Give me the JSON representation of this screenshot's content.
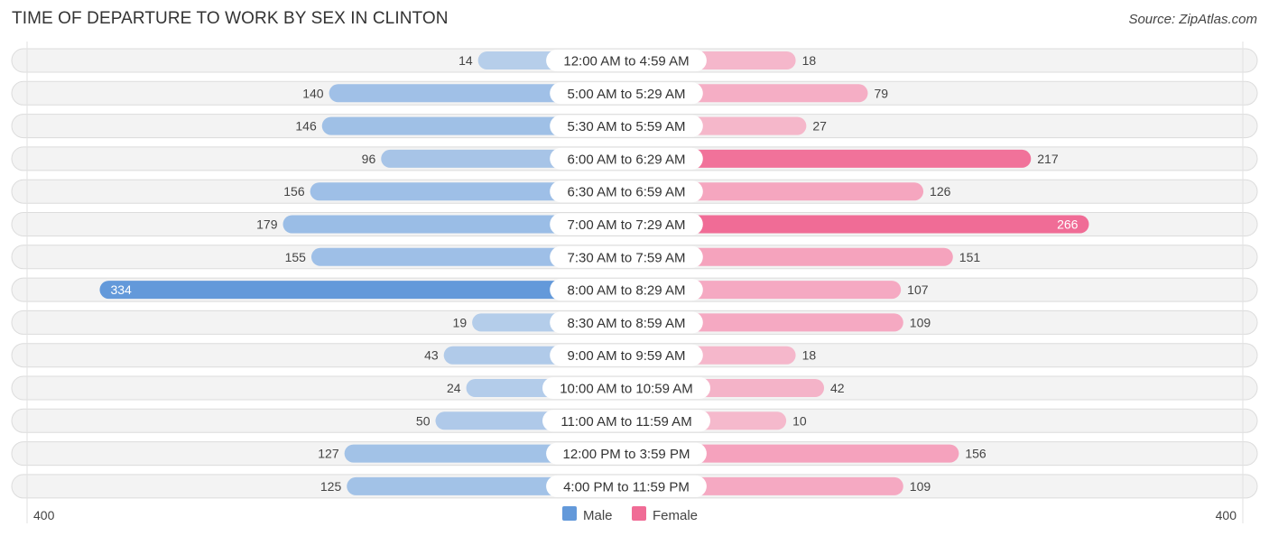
{
  "header": {
    "title": "TIME OF DEPARTURE TO WORK BY SEX IN CLINTON",
    "source": "Source: ZipAtlas.com"
  },
  "colors": {
    "male": "#8fb6e4",
    "male_strong": "#6399da",
    "female": "#f594b3",
    "female_strong": "#f06c96"
  },
  "chart_data": {
    "type": "bar",
    "orientation": "horizontal-diverging",
    "title": "TIME OF DEPARTURE TO WORK BY SEX IN CLINTON",
    "categories": [
      "12:00 AM to 4:59 AM",
      "5:00 AM to 5:29 AM",
      "5:30 AM to 5:59 AM",
      "6:00 AM to 6:29 AM",
      "6:30 AM to 6:59 AM",
      "7:00 AM to 7:29 AM",
      "7:30 AM to 7:59 AM",
      "8:00 AM to 8:29 AM",
      "8:30 AM to 8:59 AM",
      "9:00 AM to 9:59 AM",
      "10:00 AM to 10:59 AM",
      "11:00 AM to 11:59 AM",
      "12:00 PM to 3:59 PM",
      "4:00 PM to 11:59 PM"
    ],
    "series": [
      {
        "name": "Male",
        "side": "left",
        "values": [
          14,
          140,
          146,
          96,
          156,
          179,
          155,
          334,
          19,
          43,
          24,
          50,
          127,
          125
        ]
      },
      {
        "name": "Female",
        "side": "right",
        "values": [
          18,
          79,
          27,
          217,
          126,
          266,
          151,
          107,
          109,
          18,
          42,
          10,
          156,
          109
        ]
      }
    ],
    "axis": {
      "left_label": "400",
      "right_label": "400",
      "range": [
        0,
        400
      ]
    },
    "legend": {
      "position": "bottom-center",
      "entries": [
        "Male",
        "Female"
      ]
    },
    "grid": false
  }
}
